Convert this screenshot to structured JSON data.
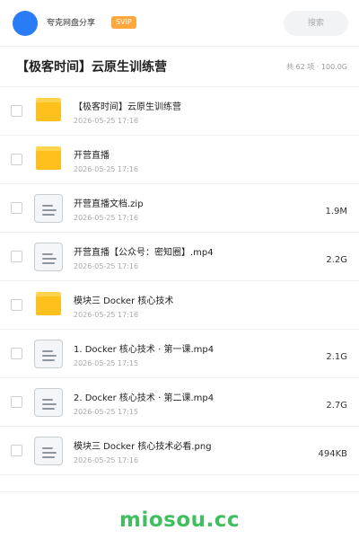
{
  "header": {
    "user_name": "夸克网盘分享",
    "badge": "SVIP",
    "search_placeholder": "搜索"
  },
  "folder": {
    "title": "【极客时间】云原生训练营",
    "summary": "共 62 项 · 100.0G"
  },
  "files": [
    {
      "name": "【极客时间】云原生训练营",
      "date": "2026-05-25 17:16",
      "size": "",
      "icon": "folder-icon"
    },
    {
      "name": "开营直播",
      "date": "2026-05-25 17:16",
      "size": "",
      "icon": "folder-icon"
    },
    {
      "name": "开营直播文档.zip",
      "date": "2026-05-25 17:16",
      "size": "1.9M",
      "icon": "file-icon"
    },
    {
      "name": "开营直播【公众号：密知圈】.mp4",
      "date": "2026-05-25 17:16",
      "size": "2.2G",
      "icon": "file-icon"
    },
    {
      "name": "模块三 Docker 核心技术",
      "date": "2026-05-25 17:16",
      "size": "",
      "icon": "folder-icon"
    },
    {
      "name": "1. Docker 核心技术 · 第一课.mp4",
      "date": "2026-05-25 17:15",
      "size": "2.1G",
      "icon": "file-icon"
    },
    {
      "name": "2. Docker 核心技术 · 第二课.mp4",
      "date": "2026-05-25 17:15",
      "size": "2.7G",
      "icon": "file-icon"
    },
    {
      "name": "模块三 Docker 核心技术必看.png",
      "date": "2026-05-25 17:16",
      "size": "494KB",
      "icon": "file-icon"
    }
  ],
  "footer": {
    "watermark": "miosou.cc"
  },
  "colors": {
    "avatar": "#2a7bf6",
    "svip_badge": "#fda73d",
    "folder": "#ffc01d",
    "watermark": "#3fbf5f"
  }
}
